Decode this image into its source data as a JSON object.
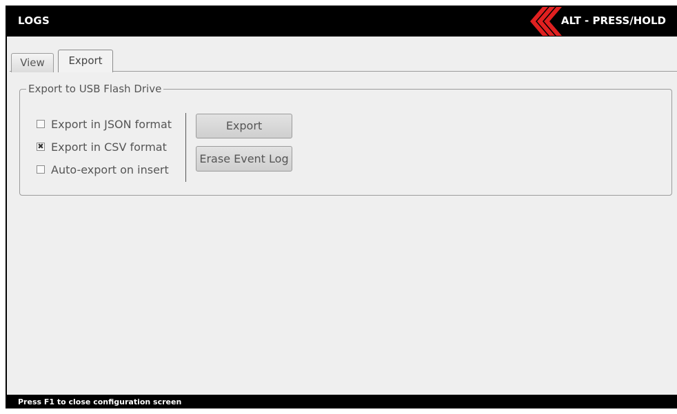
{
  "header": {
    "title": "LOGS",
    "alt_hint": "ALT - PRESS/HOLD",
    "logo_icon": "red-chevron-logo-icon",
    "accent_color": "#e02020"
  },
  "tabs": [
    {
      "label": "View",
      "selected": false
    },
    {
      "label": "Export",
      "selected": true
    }
  ],
  "export_group": {
    "legend": "Export to USB Flash Drive",
    "options": [
      {
        "label": "Export in JSON format",
        "checked": false
      },
      {
        "label": "Export in CSV format",
        "checked": true
      },
      {
        "label": "Auto-export on insert",
        "checked": false
      }
    ],
    "export_button": "Export",
    "erase_button": "Erase Event Log"
  },
  "footer": {
    "hint": "Press F1 to close configuration screen"
  }
}
